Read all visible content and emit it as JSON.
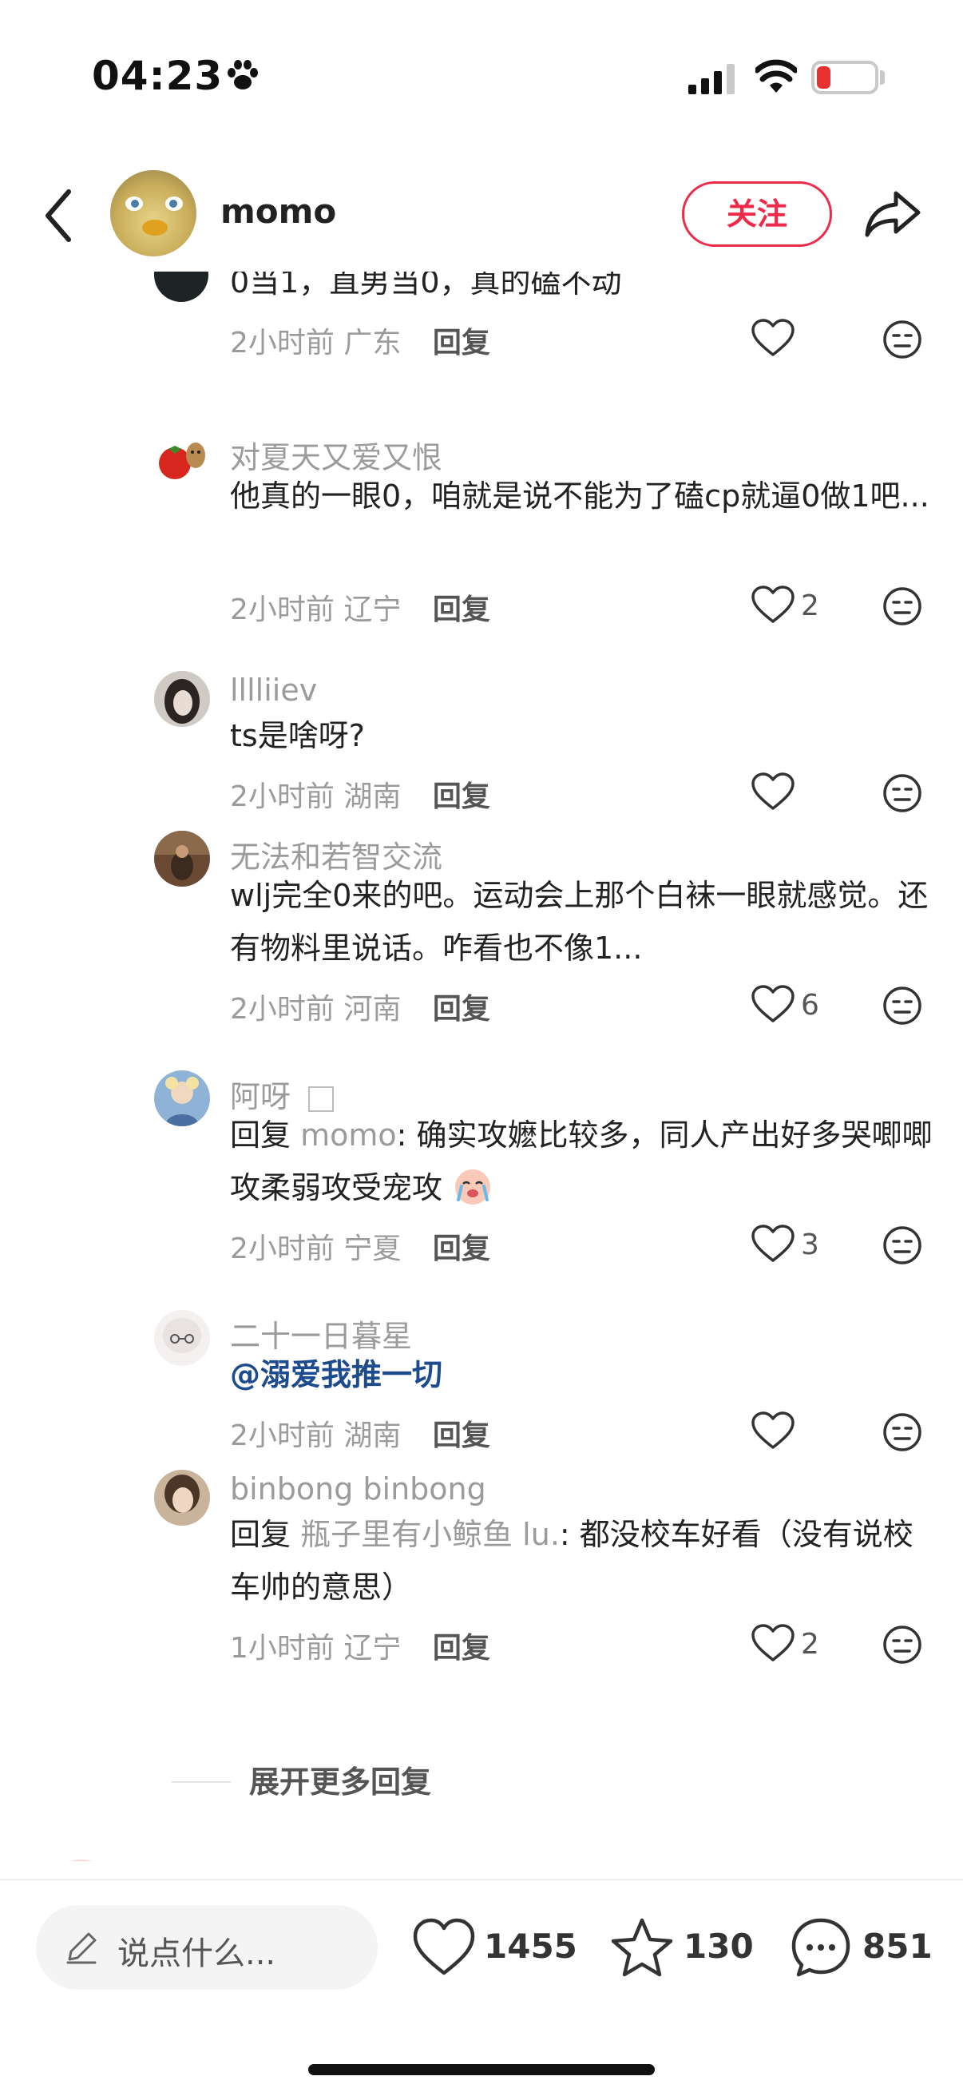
{
  "status_bar": {
    "time": "04:23",
    "battery": "17"
  },
  "header": {
    "username": "momo",
    "follow_label": "关注"
  },
  "comments": [
    {
      "name": "",
      "text": "0当1，直男当0，真的磕不动",
      "time": "2小时前",
      "location": "广东",
      "reply_label": "回复",
      "likes": ""
    },
    {
      "name": "对夏天又爱又恨",
      "text": "他真的一眼0，咱就是说不能为了磕cp就逼0做1吧...",
      "time": "2小时前",
      "location": "辽宁",
      "reply_label": "回复",
      "likes": "2"
    },
    {
      "name": "lllliiev",
      "text": "ts是啥呀?",
      "time": "2小时前",
      "location": "湖南",
      "reply_label": "回复",
      "likes": ""
    },
    {
      "name": "无法和若智交流",
      "text": "wlj完全0来的吧。运动会上那个白袜一眼就感觉。还有物料里说话。咋看也不像1...",
      "time": "2小时前",
      "location": "河南",
      "reply_label": "回复",
      "likes": "6"
    },
    {
      "name": "阿呀",
      "reply_prefix": "回复 ",
      "reply_to": "momo",
      "text": ": 确实攻嬷比较多，同人产出好多哭唧唧攻柔弱攻受宠攻",
      "time": "2小时前",
      "location": "宁夏",
      "reply_label": "回复",
      "likes": "3"
    },
    {
      "name": "二十一日暮星",
      "text": "@溺爱我推一切",
      "time": "2小时前",
      "location": "湖南",
      "reply_label": "回复",
      "likes": ""
    },
    {
      "name": "binbong binbong",
      "reply_prefix": "回复 ",
      "reply_to": "瓶子里有小鲸鱼 lu.",
      "text": ": 都没校车好看（没有说校车帅的意思）",
      "time": "1小时前",
      "location": "辽宁",
      "reply_label": "回复",
      "likes": "2"
    }
  ],
  "more_replies_label": "展开更多回复",
  "bottom_bar": {
    "input_placeholder": "说点什么...",
    "likes": "1455",
    "favorites": "130",
    "comments": "851"
  },
  "icons": [
    "paw-icon",
    "signal-icon",
    "wifi-icon",
    "back-icon",
    "share-icon",
    "heart-icon",
    "dislike-icon",
    "pen-icon",
    "star-icon",
    "comment-icon"
  ],
  "colors": {
    "accent": "#ee2a4b",
    "mention_link": "#1e4b8e",
    "muted": "#9b9b9b"
  }
}
